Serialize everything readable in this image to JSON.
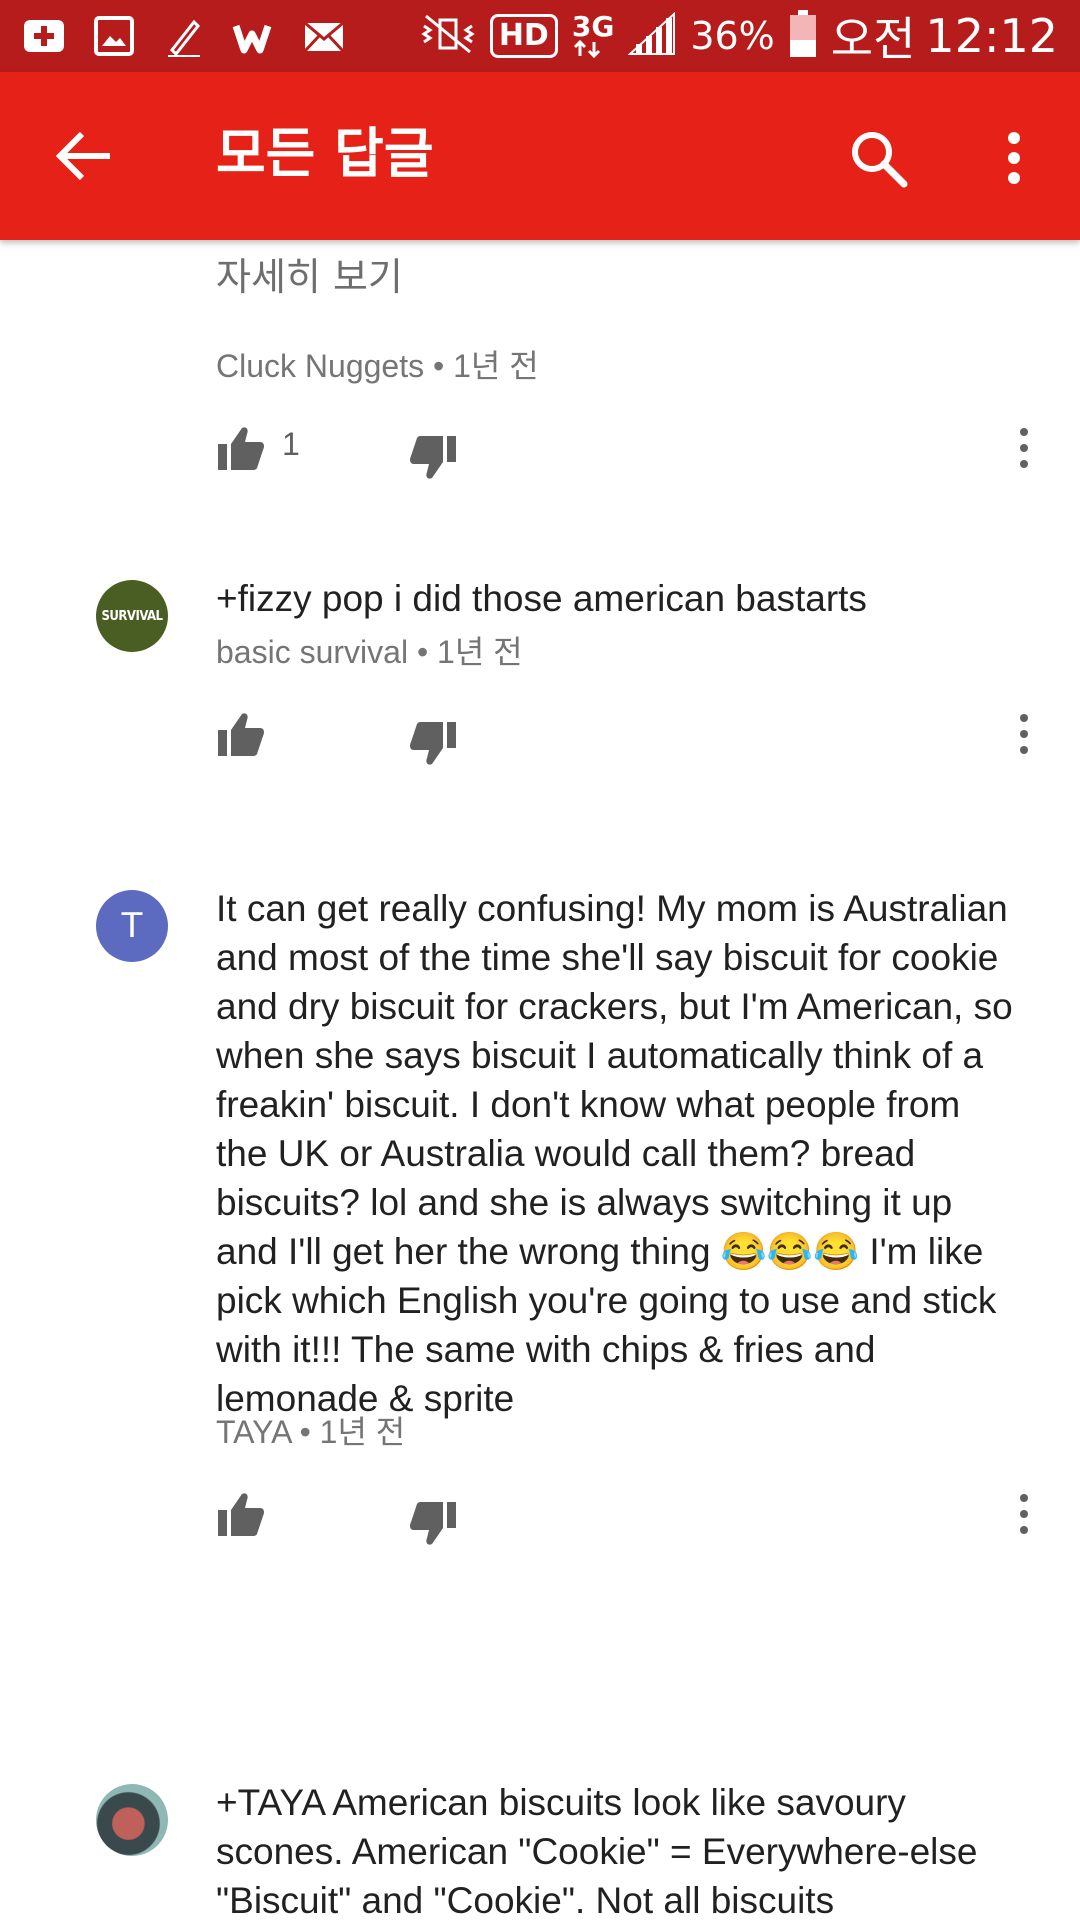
{
  "status_bar": {
    "battery": "36%",
    "ampm": "오전",
    "time": "12:12",
    "hd_label": "HD",
    "network_label": "3G",
    "notif_icons": [
      "plus-icon",
      "image-icon",
      "pen-icon",
      "w-app-icon",
      "mail-icon"
    ],
    "colors": {
      "background": "#b71c1c"
    }
  },
  "app_bar": {
    "title": "모든 답글",
    "colors": {
      "background": "#e62117"
    }
  },
  "thread": {
    "read_more": "자세히 보기",
    "comments": [
      {
        "text": "",
        "author": "Cluck Nuggets",
        "time": "1년 전",
        "likes": "1"
      },
      {
        "avatar_text": "SURVIVAL",
        "text": "+fizzy pop i did those american bastarts",
        "author": "basic survival",
        "time": "1년 전",
        "likes": ""
      },
      {
        "avatar_text": "T",
        "text": "It can get really confusing! My mom is Australian and most of the time she'll say biscuit for cookie and dry biscuit for crackers, but I'm American, so when she says biscuit I automatically think of a freakin' biscuit. I don't know what people from the UK or Australia would call them? bread biscuits? lol and she is always switching it up and I'll get her the wrong thing 😂😂😂 I'm like pick which English you're going to use and stick with it!!! The same with chips & fries and lemonade & sprite",
        "author": "TAYA",
        "time": "1년 전",
        "likes": ""
      },
      {
        "text": "+TAYA  American biscuits look like savoury scones. American \"Cookie\" = Everywhere-else \"Biscuit\" and \"Cookie\". Not all biscuits",
        "author": "",
        "time": ""
      }
    ],
    "separator": "•"
  }
}
